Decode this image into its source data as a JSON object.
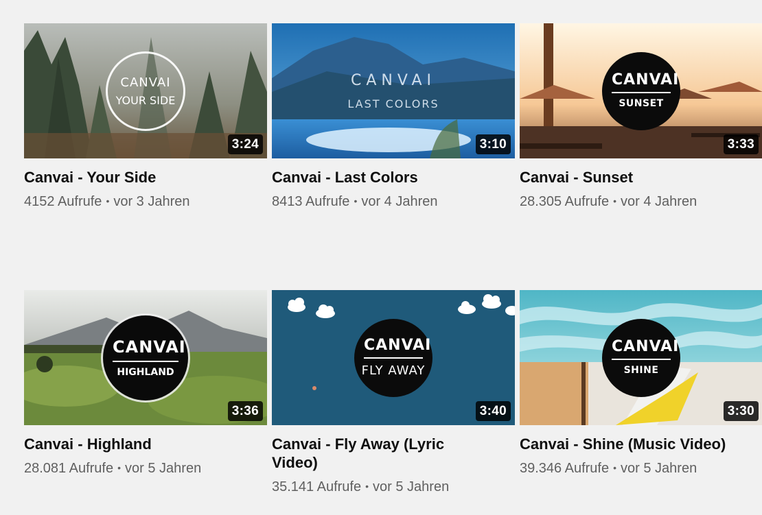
{
  "videos": [
    {
      "title": "Canvai - Your Side",
      "views": "4152 Aufrufe",
      "age": "vor 3 Jahren",
      "duration": "3:24",
      "logo_brand": "CANVAI",
      "logo_sub": "YOUR SIDE"
    },
    {
      "title": "Canvai - Last Colors",
      "views": "8413 Aufrufe",
      "age": "vor 4 Jahren",
      "duration": "3:10",
      "logo_brand": "CANVAI",
      "logo_sub": "LAST COLORS"
    },
    {
      "title": "Canvai - Sunset",
      "views": "28.305 Aufrufe",
      "age": "vor 4 Jahren",
      "duration": "3:33",
      "logo_brand": "CANVAI",
      "logo_sub": "SUNSET"
    },
    {
      "title": "Canvai - Highland",
      "views": "28.081 Aufrufe",
      "age": "vor 5 Jahren",
      "duration": "3:36",
      "logo_brand": "CANVAI",
      "logo_sub": "HIGHLAND"
    },
    {
      "title": "Canvai - Fly Away (Lyric Video)",
      "views": "35.141 Aufrufe",
      "age": "vor 5 Jahren",
      "duration": "3:40",
      "logo_brand": "CANVAI",
      "logo_sub": "FLY AWAY"
    },
    {
      "title": "Canvai - Shine (Music Video)",
      "views": "39.346 Aufrufe",
      "age": "vor 5 Jahren",
      "duration": "3:30",
      "logo_brand": "CANVAI",
      "logo_sub": "SHINE"
    }
  ],
  "separator": "•"
}
